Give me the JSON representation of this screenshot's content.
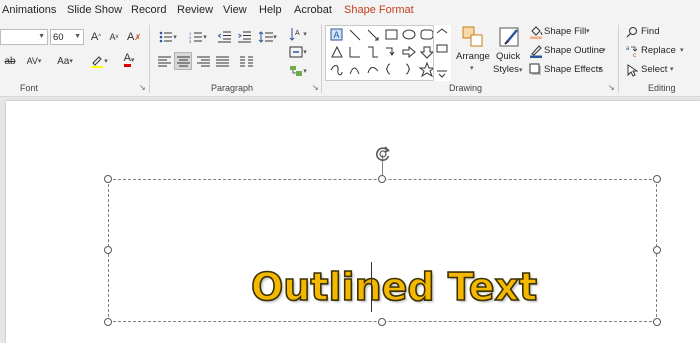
{
  "tabs": [
    "Animations",
    "Slide Show",
    "Record",
    "Review",
    "View",
    "Help",
    "Acrobat",
    "Shape Format"
  ],
  "ribbon": {
    "font": {
      "size_value": "60",
      "group_label": "Font"
    },
    "paragraph": {
      "group_label": "Paragraph"
    },
    "drawing": {
      "group_label": "Drawing",
      "arrange_label": "Arrange",
      "quick_styles_line1": "Quick",
      "quick_styles_line2": "Styles",
      "shape_fill": "Shape Fill",
      "shape_outline": "Shape Outline",
      "shape_effects": "Shape Effects"
    },
    "editing": {
      "group_label": "Editing",
      "find": "Find",
      "replace": "Replace",
      "select": "Select"
    }
  },
  "slide": {
    "text": "Outlined Text"
  },
  "colors": {
    "accent": "#c43e1c",
    "text_fill": "#f5b800",
    "text_outline": "#3a3000"
  }
}
